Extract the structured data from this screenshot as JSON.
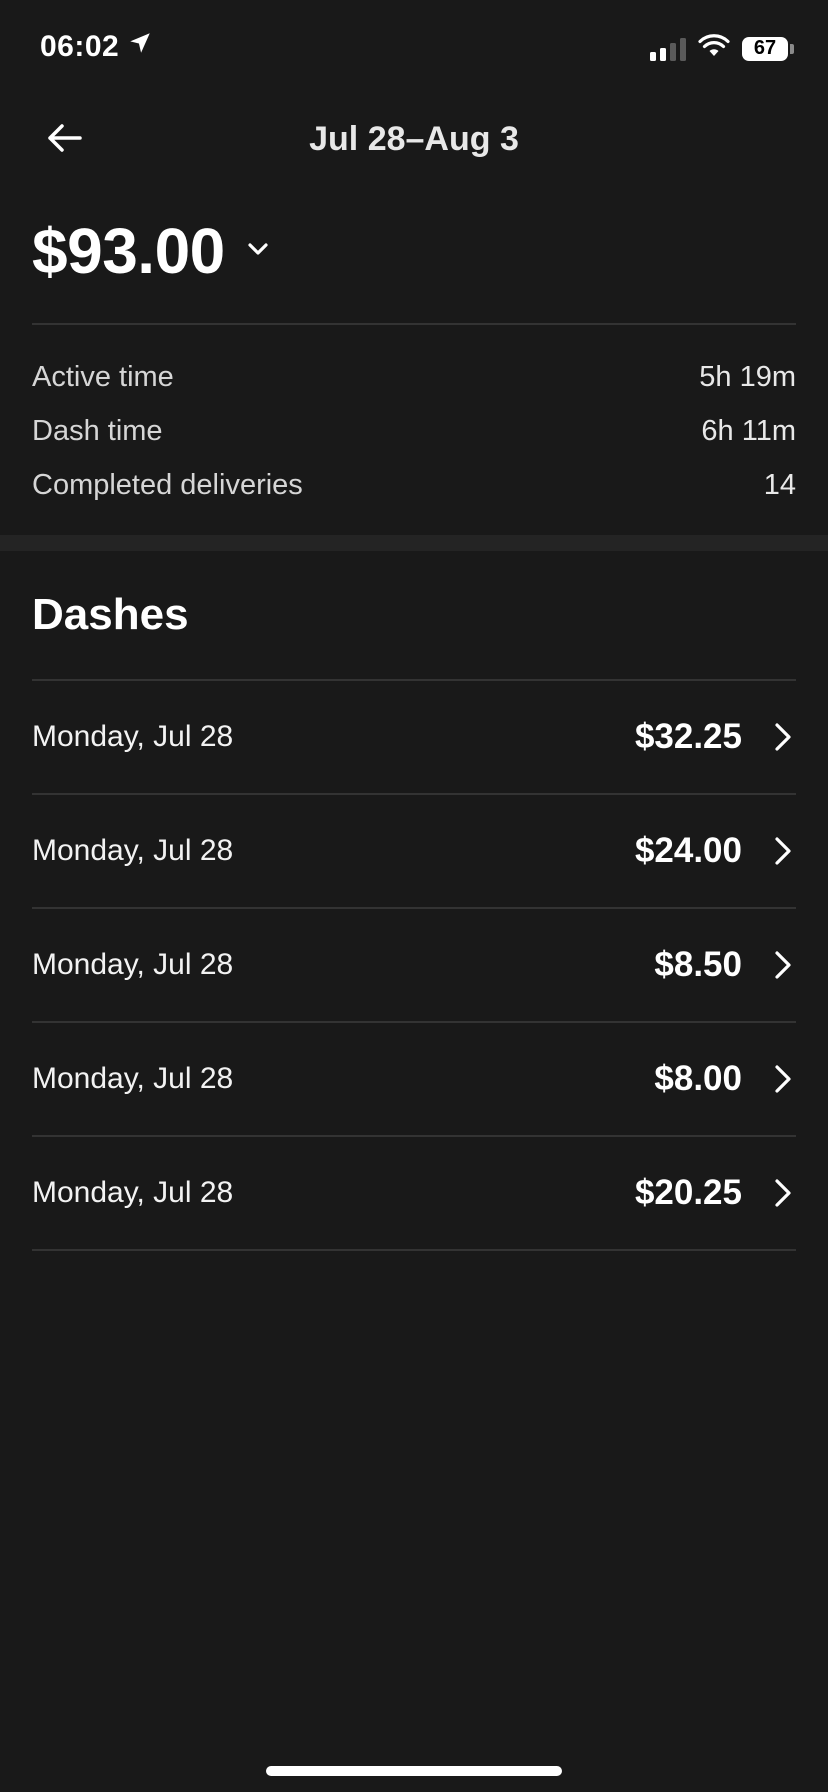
{
  "status_bar": {
    "time": "06:02",
    "battery": "67",
    "icons": [
      "location-arrow-icon",
      "signal-icon",
      "wifi-icon",
      "battery-icon"
    ]
  },
  "header": {
    "title": "Jul 28–Aug 3",
    "back_icon": "arrow-left-icon"
  },
  "summary": {
    "total": "$93.00",
    "expand_icon": "chevron-down-icon",
    "stats": [
      {
        "label": "Active time",
        "value": "5h 19m"
      },
      {
        "label": "Dash time",
        "value": "6h 11m"
      },
      {
        "label": "Completed deliveries",
        "value": "14"
      }
    ]
  },
  "dashes": {
    "title": "Dashes",
    "items": [
      {
        "date": "Monday, Jul 28",
        "amount": "$32.25"
      },
      {
        "date": "Monday, Jul 28",
        "amount": "$24.00"
      },
      {
        "date": "Monday, Jul 28",
        "amount": "$8.50"
      },
      {
        "date": "Monday, Jul 28",
        "amount": "$8.00"
      },
      {
        "date": "Monday, Jul 28",
        "amount": "$20.25"
      }
    ]
  },
  "colors": {
    "background": "#191919",
    "text": "#ffffff",
    "divider": "#333333",
    "muted": "#d6d6d6"
  }
}
